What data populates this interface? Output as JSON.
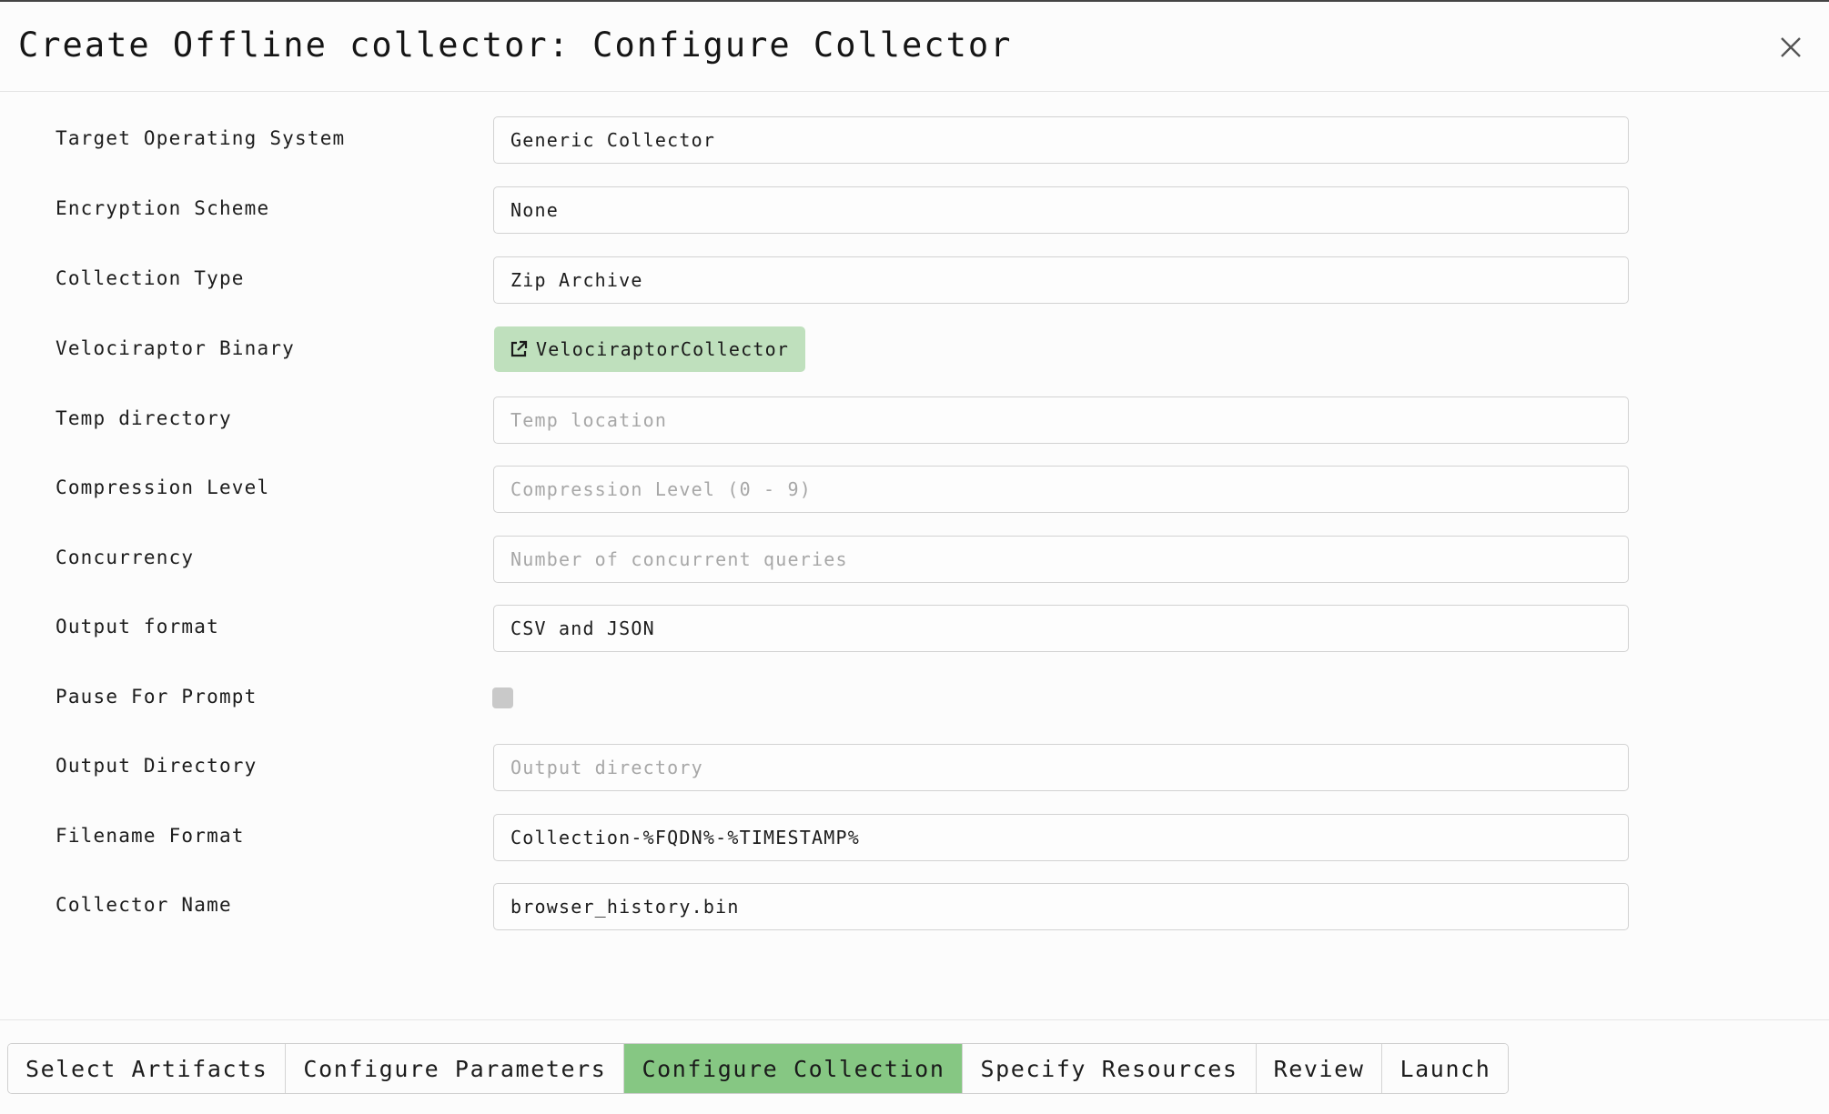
{
  "dialog": {
    "title": "Create Offline collector: Configure Collector"
  },
  "form": {
    "target_os": {
      "label": "Target Operating System",
      "value": "Generic Collector"
    },
    "encryption": {
      "label": "Encryption Scheme",
      "value": "None"
    },
    "collection_type": {
      "label": "Collection Type",
      "value": "Zip Archive"
    },
    "binary": {
      "label": "Velociraptor Binary",
      "button_label": "VelociraptorCollector",
      "icon": "external-link-icon"
    },
    "temp_dir": {
      "label": "Temp directory",
      "value": "",
      "placeholder": "Temp location"
    },
    "compression": {
      "label": "Compression Level",
      "value": "",
      "placeholder": "Compression Level (0 - 9)"
    },
    "concurrency": {
      "label": "Concurrency",
      "value": "",
      "placeholder": "Number of concurrent queries"
    },
    "output_format": {
      "label": "Output format",
      "value": "CSV and JSON"
    },
    "pause_prompt": {
      "label": "Pause For Prompt",
      "checked": false
    },
    "output_dir": {
      "label": "Output Directory",
      "value": "",
      "placeholder": "Output directory"
    },
    "filename_format": {
      "label": "Filename Format",
      "value": "Collection-%FQDN%-%TIMESTAMP%"
    },
    "collector_name": {
      "label": "Collector Name",
      "value": "browser_history.bin"
    }
  },
  "steps": [
    {
      "label": "Select Artifacts",
      "active": false
    },
    {
      "label": "Configure Parameters",
      "active": false
    },
    {
      "label": "Configure Collection",
      "active": true
    },
    {
      "label": "Specify Resources",
      "active": false
    },
    {
      "label": "Review",
      "active": false
    },
    {
      "label": "Launch",
      "active": false
    }
  ],
  "colors": {
    "active_step": "#86c783",
    "binary_button": "#bfe0bd",
    "checkbox": "#c9c9c9"
  }
}
